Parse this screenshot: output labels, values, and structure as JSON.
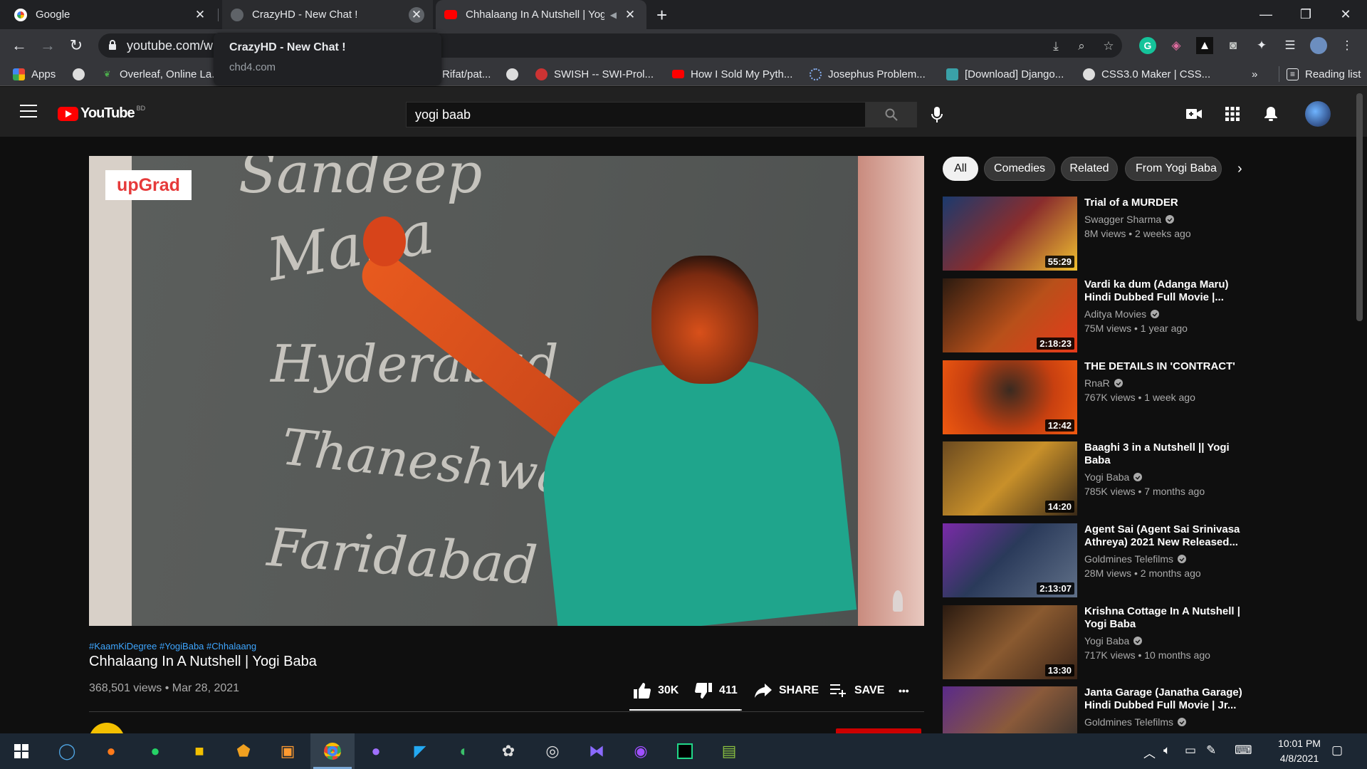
{
  "browser": {
    "tabs": [
      {
        "title": "Google",
        "active": false
      },
      {
        "title": "CrazyHD - New Chat !",
        "active": false
      },
      {
        "title": "Chhalaang In A Nutshell | Yog",
        "active": true
      }
    ],
    "url": "youtube.com/w",
    "tooltip": {
      "title": "CrazyHD - New Chat !",
      "host": "chd4.com"
    },
    "bookmarks": [
      "Apps",
      "Overleaf, Online La...",
      "Rifat/pat...",
      "SWISH -- SWI-Prol...",
      "How I Sold My Pyth...",
      "Josephus Problem...",
      "[Download] Django...",
      "CSS3.0 Maker | CSS..."
    ],
    "more_bookmarks": "»",
    "reading_list": "Reading list"
  },
  "youtube": {
    "logo_word": "YouTube",
    "country": "BD",
    "search_value": "yogi baab",
    "video": {
      "watermark": "upGrad",
      "chalk_words": [
        "Sandeep",
        "Mana",
        "Hyderabad",
        "Thaneshwar",
        "Faridabad"
      ],
      "hashtags": "#KaamKiDegree #YogiBaba #Chhalaang",
      "title": "Chhalaang In A Nutshell | Yogi Baba",
      "meta": "368,501 views • Mar 28, 2021",
      "likes": "30K",
      "dislikes": "411",
      "share": "SHARE",
      "save": "SAVE",
      "more": "•••",
      "like_ratio": 0.986
    },
    "chips": [
      "All",
      "Comedies",
      "Related",
      "From Yogi Baba"
    ],
    "chip_next": "›",
    "recommendations": [
      {
        "title": "Trial of a MURDER",
        "channel": "Swagger Sharma",
        "meta": "8M views • 2 weeks ago",
        "duration": "55:29"
      },
      {
        "title": "Vardi ka dum (Adanga Maru) Hindi Dubbed Full Movie |...",
        "channel": "Aditya Movies",
        "meta": "75M views • 1 year ago",
        "duration": "2:18:23"
      },
      {
        "title": "THE DETAILS IN 'CONTRACT'",
        "channel": "RnaR",
        "meta": "767K views • 1 week ago",
        "duration": "12:42"
      },
      {
        "title": "Baaghi 3 in a Nutshell || Yogi Baba",
        "channel": "Yogi Baba",
        "meta": "785K views • 7 months ago",
        "duration": "14:20"
      },
      {
        "title": "Agent Sai (Agent Sai Srinivasa Athreya) 2021 New Released...",
        "channel": "Goldmines Telefilms",
        "meta": "28M views • 2 months ago",
        "duration": "2:13:07"
      },
      {
        "title": "Krishna Cottage In A Nutshell | Yogi Baba",
        "channel": "Yogi Baba",
        "meta": "717K views • 10 months ago",
        "duration": "13:30"
      },
      {
        "title": "Janta Garage (Janatha Garage) Hindi Dubbed Full Movie | Jr...",
        "channel": "Goldmines Telefilms",
        "meta": "",
        "duration": ""
      }
    ]
  },
  "taskbar": {
    "time": "10:01 PM",
    "date": "4/8/2021"
  },
  "colors": {
    "accent_red": "#ff0000",
    "link_blue": "#3ea6ff",
    "taskbar": "#1c2733"
  }
}
